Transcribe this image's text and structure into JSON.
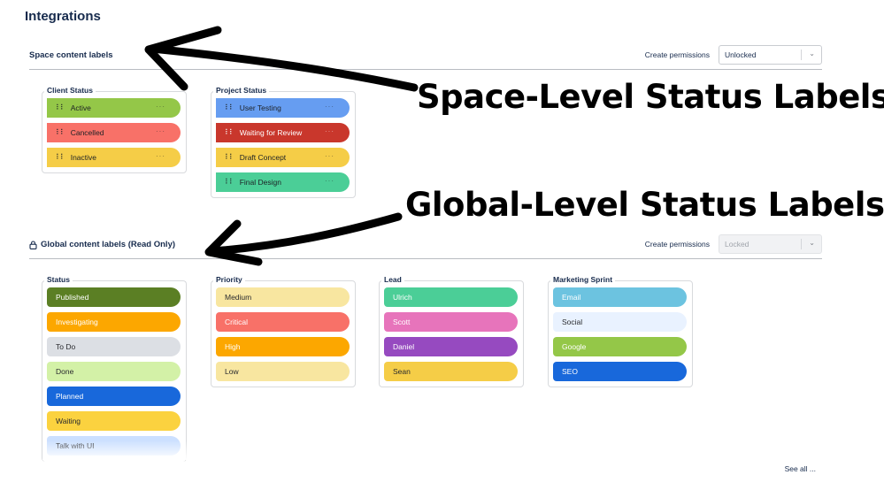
{
  "page_title": "Integrations",
  "space_section": {
    "title": "Space content labels",
    "perm_label": "Create permissions",
    "perm_value": "Unlocked",
    "groups": [
      {
        "title": "Client Status",
        "labels": [
          {
            "name": "Active",
            "color": "#94c748"
          },
          {
            "name": "Cancelled",
            "color": "#f87168"
          },
          {
            "name": "Inactive",
            "color": "#f5cd47"
          }
        ]
      },
      {
        "title": "Project Status",
        "labels": [
          {
            "name": "User Testing",
            "color": "#669df1"
          },
          {
            "name": "Waiting for Review",
            "color": "#c9372c"
          },
          {
            "name": "Draft Concept",
            "color": "#f5cd47"
          },
          {
            "name": "Final Design",
            "color": "#4bce97"
          }
        ]
      }
    ]
  },
  "global_section": {
    "title": "Global content labels (Read Only)",
    "perm_label": "Create permissions",
    "perm_value": "Locked",
    "groups": [
      {
        "title": "Status",
        "labels": [
          {
            "name": "Published",
            "color": "#5b7f24"
          },
          {
            "name": "Investigating",
            "color": "#fca700"
          },
          {
            "name": "To Do",
            "color": "#dcdfe4"
          },
          {
            "name": "Done",
            "color": "#d3f1a7"
          },
          {
            "name": "Planned",
            "color": "#1868db"
          },
          {
            "name": "Waiting",
            "color": "#fbd23f"
          },
          {
            "name": "Talk with UI",
            "color": "#cce0ff"
          }
        ]
      },
      {
        "title": "Priority",
        "labels": [
          {
            "name": "Medium",
            "color": "#f8e6a0"
          },
          {
            "name": "Critical",
            "color": "#f87168"
          },
          {
            "name": "High",
            "color": "#fca700"
          },
          {
            "name": "Low",
            "color": "#f8e6a0"
          }
        ]
      },
      {
        "title": "Lead",
        "labels": [
          {
            "name": "Ulrich",
            "color": "#4bce97"
          },
          {
            "name": "Scott",
            "color": "#e774bb"
          },
          {
            "name": "Daniel",
            "color": "#964ac0"
          },
          {
            "name": "Sean",
            "color": "#f5cd47"
          }
        ]
      },
      {
        "title": "Marketing Sprint",
        "labels": [
          {
            "name": "Email",
            "color": "#6cc3e0"
          },
          {
            "name": "Social",
            "color": "#e9f2ff"
          },
          {
            "name": "Google",
            "color": "#94c748"
          },
          {
            "name": "SEO",
            "color": "#1868db"
          }
        ]
      }
    ]
  },
  "see_all": "See all ...",
  "annotations": {
    "space_level": "Space-Level Status Labels",
    "global_level": "Global-Level Status Labels"
  }
}
